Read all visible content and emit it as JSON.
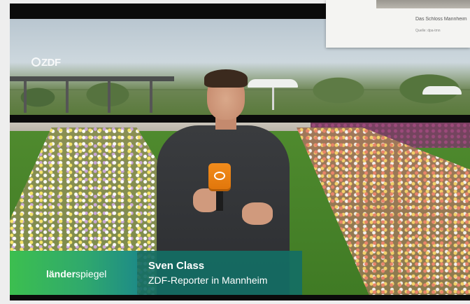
{
  "broadcaster": {
    "logo_text": "ZDF"
  },
  "lower_third": {
    "show_bold": "länder",
    "show_light": "spiegel",
    "name": "Sven Class",
    "role": "ZDF-Reporter in Mannheim",
    "colors": {
      "green": "#3cbf4f",
      "teal": "#146e64"
    }
  },
  "popup": {
    "caption": "Das Schloss Mannheim",
    "source": "Quelle: dpa-tmn"
  },
  "icons": [
    "zdf-logo-icon",
    "microphone-icon"
  ]
}
